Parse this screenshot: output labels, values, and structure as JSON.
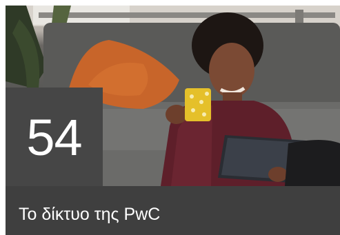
{
  "tile": {
    "stat_value": "54",
    "caption": "Το δίκτυο της PwC",
    "photo_description_icon": "woman-with-tablet-photo"
  },
  "colors": {
    "caption_bar": "#3f3f3f",
    "stat_box": "#464646",
    "text": "#ffffff"
  }
}
